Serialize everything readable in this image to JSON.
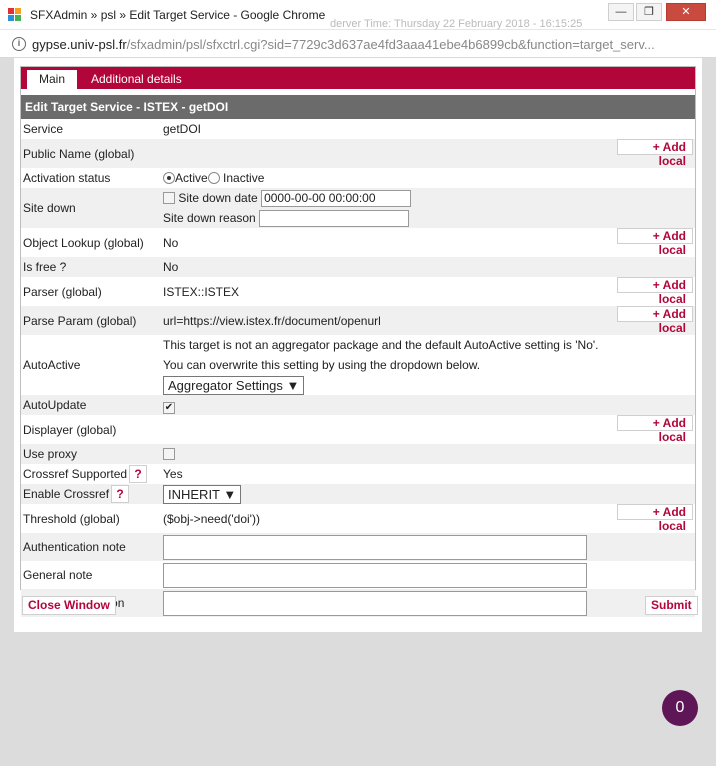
{
  "window": {
    "title": "SFXAdmin » psl » Edit Target Service - Google Chrome",
    "ghost_text": "derver Time: Thursday 22 February 2018 - 16:15:25",
    "minimize": "—",
    "maximize": "❐",
    "close": "✕",
    "info_glyph": "i",
    "colors": {
      "brand": "#b2063a",
      "header": "#6b6b6b",
      "fab": "#5e1656"
    }
  },
  "url": {
    "host": "gypse.univ-psl.fr",
    "path": "/sfxadmin/psl/sfxctrl.cgi?sid=7729c3d637ae4fd3aaa41ebe4b6899cb&function=target_serv..."
  },
  "tabs": [
    {
      "label": "Main",
      "active": true
    },
    {
      "label": "Additional details",
      "active": false
    }
  ],
  "section_title": "Edit Target Service - ISTEX - getDOI",
  "add_local_label": "+ Add local",
  "help_glyph": "?",
  "rows": {
    "service": {
      "label": "Service",
      "value": "getDOI"
    },
    "public_name": {
      "label": "Public Name (global)"
    },
    "activation": {
      "label": "Activation status",
      "active": "Active",
      "inactive": "Inactive"
    },
    "site_down": {
      "label": "Site down",
      "date_label": "Site down date",
      "date_value": "0000-00-00 00:00:00",
      "reason_label": "Site down reason"
    },
    "object_lookup": {
      "label": "Object Lookup (global)",
      "value": "No"
    },
    "is_free": {
      "label": "Is free ?",
      "value": "No"
    },
    "parser": {
      "label": "Parser (global)",
      "value": "ISTEX::ISTEX"
    },
    "parse_param": {
      "label": "Parse Param (global)",
      "value": "url=https://view.istex.fr/document/openurl"
    },
    "autoactive": {
      "label": "AutoActive",
      "line1": "This target is not an aggregator package and the default AutoActive setting is 'No'.",
      "line2": "You can overwrite this setting by using the dropdown below.",
      "select": "Aggregator Settings"
    },
    "autoupdate": {
      "label": "AutoUpdate",
      "check": "✔"
    },
    "displayer": {
      "label": "Displayer (global)"
    },
    "use_proxy": {
      "label": "Use proxy"
    },
    "crossref_supported": {
      "label": "Crossref Supported",
      "value": "Yes"
    },
    "enable_crossref": {
      "label": "Enable Crossref",
      "select": "INHERIT"
    },
    "threshold": {
      "label": "Threshold (global)",
      "value": "($obj->need('doi'))"
    },
    "auth_note": {
      "label": "Authentication note"
    },
    "general_note": {
      "label": "General note"
    },
    "internal_desc": {
      "label": "Internal description"
    }
  },
  "buttons": {
    "close_window": "Close Window",
    "submit": "Submit"
  },
  "fab_count": "0"
}
